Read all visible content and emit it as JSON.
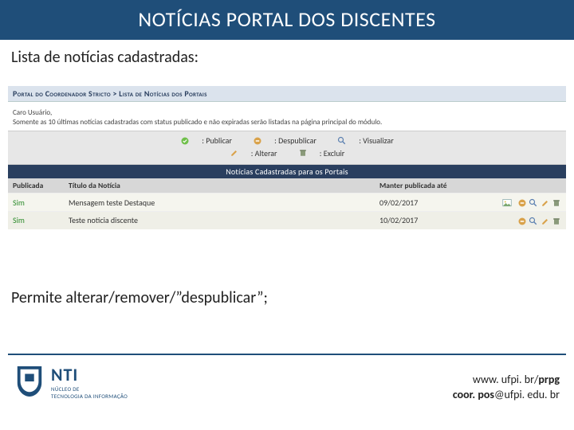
{
  "header": {
    "title": "NOTÍCIAS PORTAL DOS DISCENTES"
  },
  "subheader": "Lista de notícias cadastradas:",
  "breadcrumb": "Portal do Coordenador Stricto > Lista de Notícias dos Portais",
  "greeting": "Caro Usuário,",
  "hint": "Somente as 10 últimas notícias cadastradas com status publicado e não expiradas serão listadas na página principal do módulo.",
  "toolbar": {
    "publicar": ": Publicar",
    "despublicar": ": Despublicar",
    "visualizar": ": Visualizar",
    "alterar": ": Alterar",
    "excluir": ": Excluir"
  },
  "listbar": "Notícias Cadastradas para os Portais",
  "columns": {
    "c1": "Publicada",
    "c2": "Título da Notícia",
    "c3": "Manter publicada até",
    "c4": ""
  },
  "rows": [
    {
      "pub": "Sim",
      "titulo": "Mensagem teste Destaque",
      "ate": "09/02/2017"
    },
    {
      "pub": "Sim",
      "titulo": "Teste notícia discente",
      "ate": "10/02/2017"
    }
  ],
  "note": "Permite alterar/remover/”despublicar”;",
  "nti": {
    "big": "NTI",
    "small": "NÚCLEO DE\nTECNOLOGIA DA INFORMAÇÃO"
  },
  "contact": {
    "url_pre": "www. ufpi. br/",
    "url_bold": "prpg",
    "email_pre": "coor. pos",
    "email_post": "@ufpi. edu. br"
  }
}
